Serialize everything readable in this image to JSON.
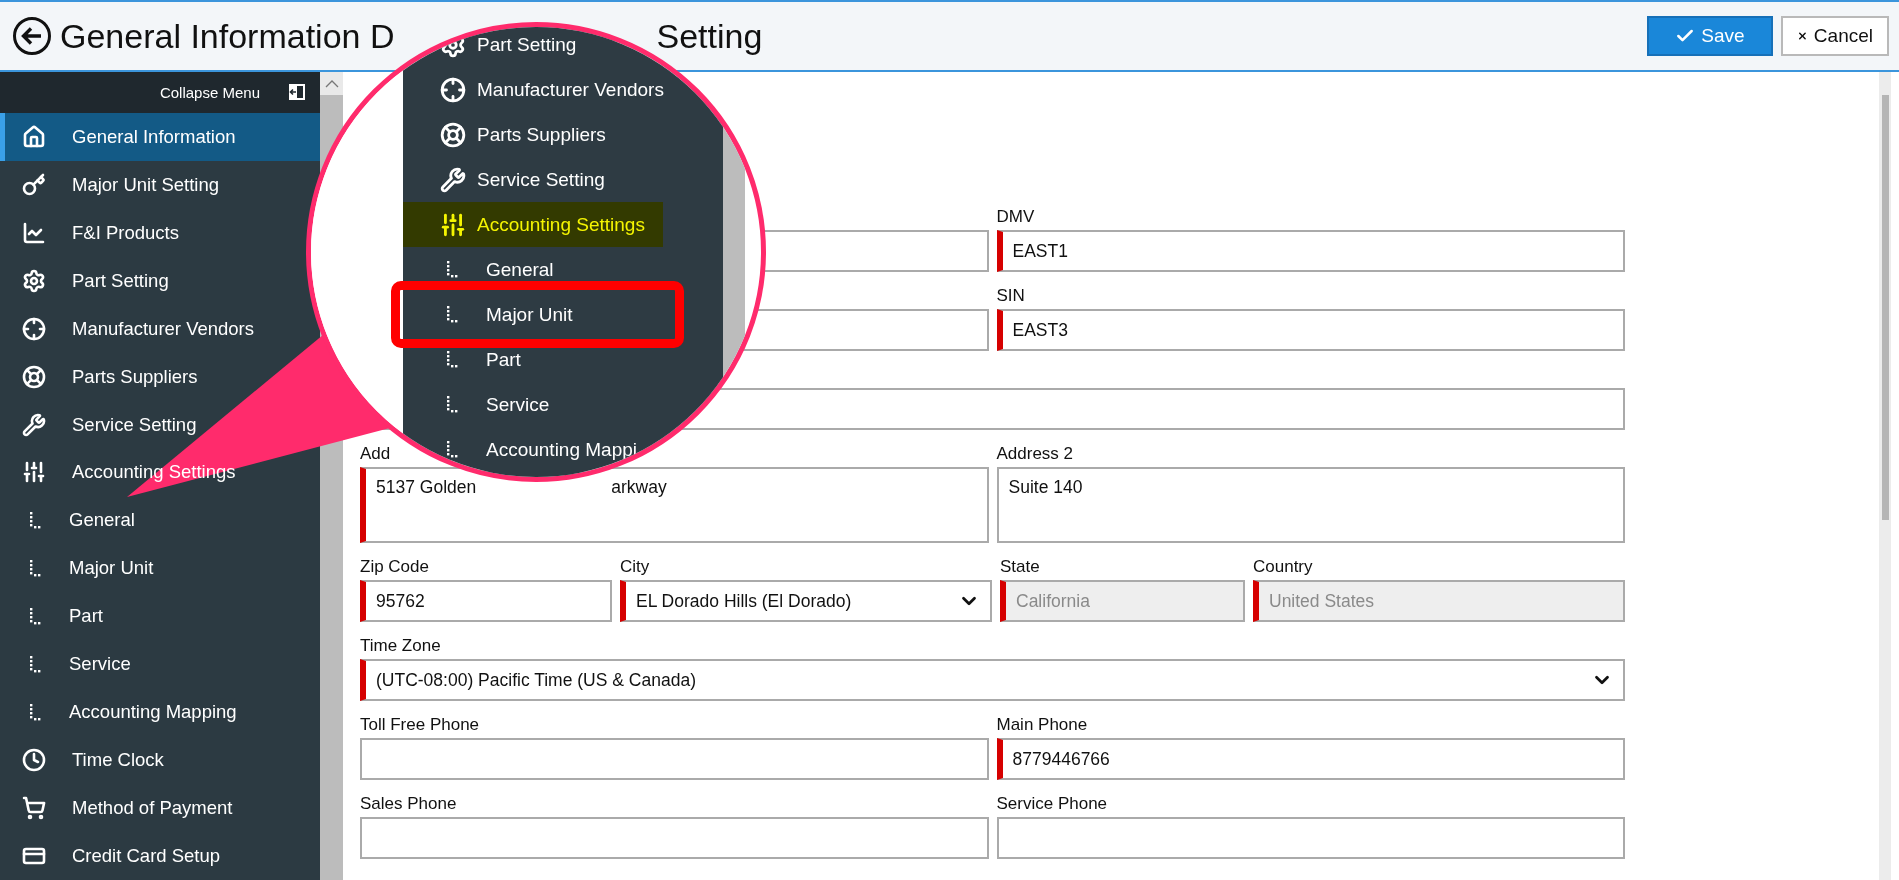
{
  "header": {
    "title_parts": [
      "General Information D",
      "Setting"
    ],
    "buttons": [
      {
        "label": "Save",
        "kind": "primary"
      },
      {
        "label": "Cancel",
        "kind": "secondary"
      }
    ]
  },
  "sidebar": {
    "collapse_label": "Collapse Menu",
    "items": [
      {
        "label": "General Information",
        "selected": true
      },
      {
        "label": "Major Unit Setting",
        "selected": false
      },
      {
        "label": "F&I Products",
        "selected": false
      },
      {
        "label": "Part Setting",
        "selected": false
      },
      {
        "label": "Manufacturer Vendors",
        "selected": false
      },
      {
        "label": "Parts Suppliers",
        "selected": false
      },
      {
        "label": "Service Setting",
        "selected": false
      },
      {
        "label": "Accounting Settings",
        "selected": false,
        "children": [
          {
            "label": "General",
            "selected": false
          },
          {
            "label": "Major Unit",
            "selected": false
          },
          {
            "label": "Part",
            "selected": false
          },
          {
            "label": "Service",
            "selected": false
          },
          {
            "label": "Accounting Mapping",
            "selected": false
          }
        ]
      },
      {
        "label": "Time Clock",
        "selected": false
      },
      {
        "label": "Method of Payment",
        "selected": false
      },
      {
        "label": "Credit Card Setup",
        "selected": false
      }
    ]
  },
  "form": {
    "rows": [
      [
        {
          "kind": "text",
          "disabled": false
        },
        {
          "kind": "text",
          "label": "DMV",
          "value": "EAST1",
          "required": true,
          "disabled": false
        }
      ],
      [
        {
          "kind": "text",
          "disabled": false
        },
        {
          "kind": "text",
          "label": "SIN",
          "value": "EAST3",
          "required": true,
          "disabled": false
        }
      ],
      [
        {
          "kind": "text",
          "disabled": false
        }
      ],
      [
        {
          "kind": "textarea",
          "label": "Add",
          "value_parts": [
            "5137 Golden",
            "arkway"
          ],
          "required": true,
          "disabled": false
        },
        {
          "kind": "textarea",
          "label": "Address 2",
          "value_parts": [
            "Suite 140"
          ],
          "required": false,
          "disabled": false
        }
      ],
      [
        {
          "kind": "text",
          "label": "Zip Code",
          "value": "95762",
          "required": true,
          "disabled": false
        },
        {
          "kind": "select",
          "label": "City",
          "value": "EL Dorado Hills (El Dorado)",
          "required": true,
          "disabled": false
        },
        {
          "kind": "text",
          "label": "State",
          "value": "California",
          "required": true,
          "disabled": true
        },
        {
          "kind": "text",
          "label": "Country",
          "value": "United States",
          "required": true,
          "disabled": true
        }
      ],
      [
        {
          "kind": "select",
          "label": "Time Zone",
          "value": "(UTC-08:00) Pacific Time (US & Canada)",
          "required": true,
          "disabled": false
        }
      ],
      [
        {
          "kind": "text",
          "label": "Toll Free Phone",
          "required": false,
          "disabled": false
        },
        {
          "kind": "text",
          "label": "Main Phone",
          "value": "8779446766",
          "required": true,
          "disabled": false
        }
      ],
      [
        {
          "kind": "text",
          "label": "Sales Phone",
          "required": false,
          "disabled": false
        },
        {
          "kind": "text",
          "label": "Service Phone",
          "required": false,
          "disabled": false
        }
      ]
    ]
  },
  "callout": {
    "items": [
      {
        "label": "Part Setting",
        "selected": false,
        "framed": false
      },
      {
        "label": "Manufacturer Vendors",
        "selected": false,
        "framed": false
      },
      {
        "label": "Parts Suppliers",
        "selected": false,
        "framed": false
      },
      {
        "label": "Service Setting",
        "selected": false,
        "framed": false
      },
      {
        "label": "Accounting Settings",
        "selected": true,
        "framed": false,
        "children": [
          {
            "label": "General",
            "selected": false,
            "framed": false
          },
          {
            "label": "Major Unit",
            "selected": false,
            "framed": true
          },
          {
            "label": "Part",
            "selected": false,
            "framed": false
          },
          {
            "label": "Service",
            "selected": false,
            "framed": false
          },
          {
            "label": "Accounting Mappi",
            "selected": false,
            "framed": false
          }
        ]
      }
    ]
  }
}
